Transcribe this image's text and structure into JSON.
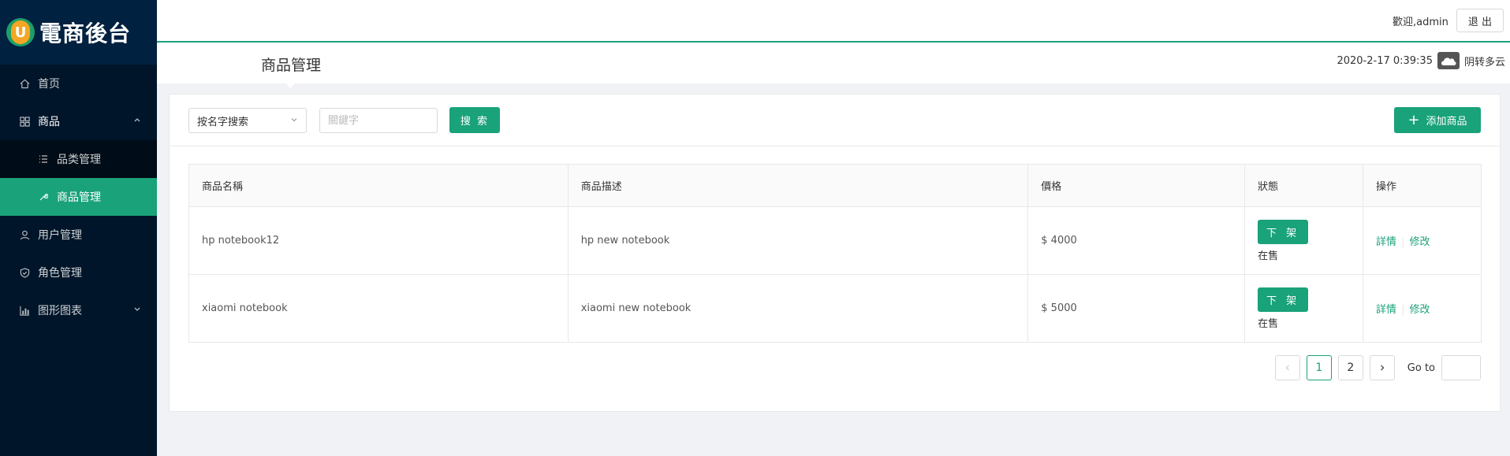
{
  "brand": {
    "logo_letter": "U",
    "title": "電商後台"
  },
  "sidebar": {
    "items": [
      {
        "label": "首页",
        "icon": "home-icon"
      },
      {
        "label": "商品",
        "icon": "appstore-icon",
        "expanded": true
      },
      {
        "label": "用户管理",
        "icon": "user-icon"
      },
      {
        "label": "角色管理",
        "icon": "shield-icon"
      },
      {
        "label": "图形图表",
        "icon": "bar-chart-icon",
        "expanded": false
      }
    ],
    "sub_items": [
      {
        "label": "品类管理",
        "icon": "list-icon"
      },
      {
        "label": "商品管理",
        "icon": "tool-icon",
        "active": true
      }
    ]
  },
  "header": {
    "welcome": "歡迎,admin",
    "logout_label": "退 出",
    "page_title": "商品管理",
    "datetime": "2020-2-17 0:39:35",
    "weather": "阴转多云"
  },
  "toolbar": {
    "search_type": "按名字搜索",
    "keyword_placeholder": "關鍵字",
    "search_label": "搜 索",
    "add_label": "添加商品"
  },
  "table": {
    "headers": [
      "商品名稱",
      "商品描述",
      "價格",
      "狀態",
      "操作"
    ],
    "rows": [
      {
        "name": "hp notebook12",
        "desc": "hp new notebook",
        "price": "$ 4000",
        "btn": "下 架",
        "status": "在售",
        "detail": "詳情",
        "edit": "修改"
      },
      {
        "name": "xiaomi notebook",
        "desc": "xiaomi new notebook",
        "price": "$ 5000",
        "btn": "下 架",
        "status": "在售",
        "detail": "詳情",
        "edit": "修改"
      }
    ]
  },
  "pagination": {
    "pages": [
      "1",
      "2"
    ],
    "current": "1",
    "goto_label": "Go to"
  },
  "colors": {
    "accent": "#1aa27a",
    "sidebar_bg": "#001529"
  }
}
